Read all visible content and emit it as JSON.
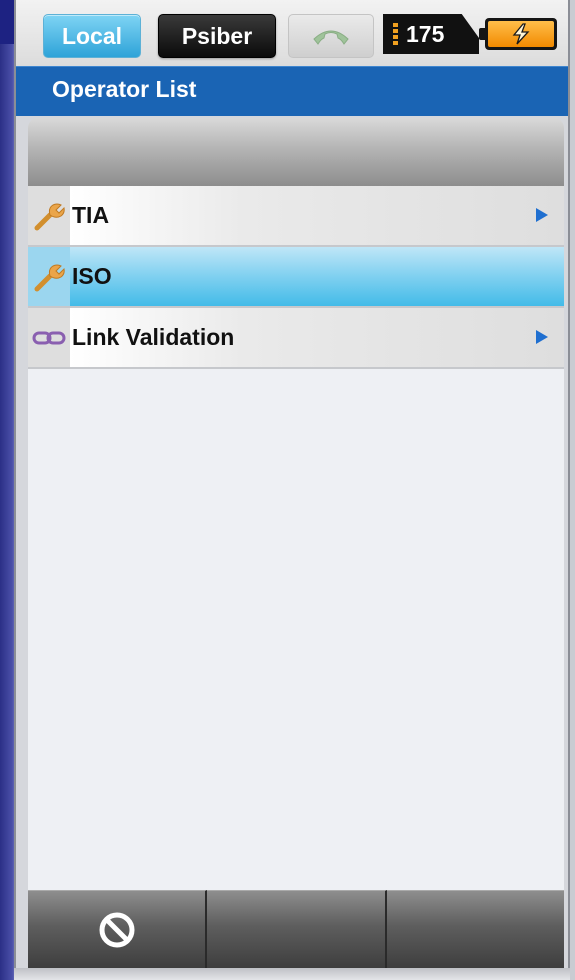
{
  "status_bar": {
    "local_label": "Local",
    "psiber_label": "Psiber",
    "phone_icon": "phone-handset-icon",
    "counter_value": "175",
    "battery_icon": "battery-charging-icon"
  },
  "title_bar": {
    "title": "Operator List"
  },
  "list": {
    "items": [
      {
        "label": "TIA",
        "icon": "wrench-icon",
        "selected": false,
        "has_arrow": true
      },
      {
        "label": "ISO",
        "icon": "wrench-icon",
        "selected": true,
        "has_arrow": false
      },
      {
        "label": "Link Validation",
        "icon": "link-icon",
        "selected": false,
        "has_arrow": true
      }
    ]
  },
  "toolbar": {
    "buttons": [
      {
        "icon": "cancel-icon"
      },
      {
        "icon": ""
      },
      {
        "icon": ""
      }
    ]
  },
  "colors": {
    "title_bar": "#1a64b4",
    "selected_row": "#4fc3ec",
    "local_button": "#2ea3d8",
    "battery": "#f28a00",
    "arrow": "#1f6fd0"
  }
}
